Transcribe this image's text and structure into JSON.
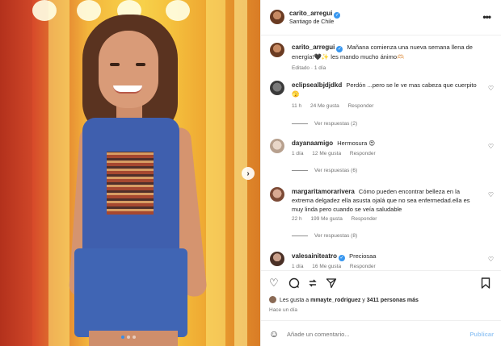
{
  "post": {
    "author": "carito_arregui",
    "location": "Santiago de Chile",
    "caption": "Mañana comienza una nueva semana llena de energía!🖤✨ les mando mucho ánimo🫶🏻",
    "caption_meta": "Editado · 1 día",
    "likes_text_prefix": "Les gusta a ",
    "likes_user": "mmayte_rodriguez",
    "likes_text_mid": " y ",
    "likes_count": "3411 personas más",
    "time_ago": "Hace un día",
    "slide_count": 3,
    "active_slide": 1
  },
  "comments": [
    {
      "user": "eclipsealbjdjdkd",
      "text": "Perdón ...pero se le ve mas cabeza que cuerpito🫣",
      "time": "11 h",
      "likes": "24 Me gusta",
      "reply": "Responder",
      "view_replies": "Ver respuestas (2)",
      "verified": false
    },
    {
      "user": "dayanaamigo",
      "text": "Hermosura 😍",
      "time": "1 día",
      "likes": "12 Me gusta",
      "reply": "Responder",
      "view_replies": "Ver respuestas (6)",
      "verified": false
    },
    {
      "user": "margaritamorarivera",
      "text": "Cómo pueden encontrar belleza en la extrema delgadez ella asusta ojalá que no sea enfermedad.ella es muy linda pero cuando se veía saludable",
      "time": "22 h",
      "likes": "199 Me gusta",
      "reply": "Responder",
      "view_replies": "Ver respuestas (8)",
      "verified": false
    },
    {
      "user": "valesainiteatro",
      "text": "Preciosaa",
      "time": "1 día",
      "likes": "16 Me gusta",
      "reply": "Responder",
      "view_replies": "",
      "verified": true
    }
  ],
  "composer": {
    "placeholder": "Añade un comentario...",
    "publish_label": "Publicar"
  },
  "icons": {
    "like": "heart-icon",
    "comment": "comment-icon",
    "repost": "repost-icon",
    "share": "send-icon",
    "save": "bookmark-icon",
    "more": "more-options-icon",
    "emoji": "emoji-icon",
    "next": "chevron-right-icon"
  },
  "colors": {
    "verified": "#3897f0",
    "publish_disabled": "#9bc9f5",
    "active_dot": "#3a8ee6"
  }
}
